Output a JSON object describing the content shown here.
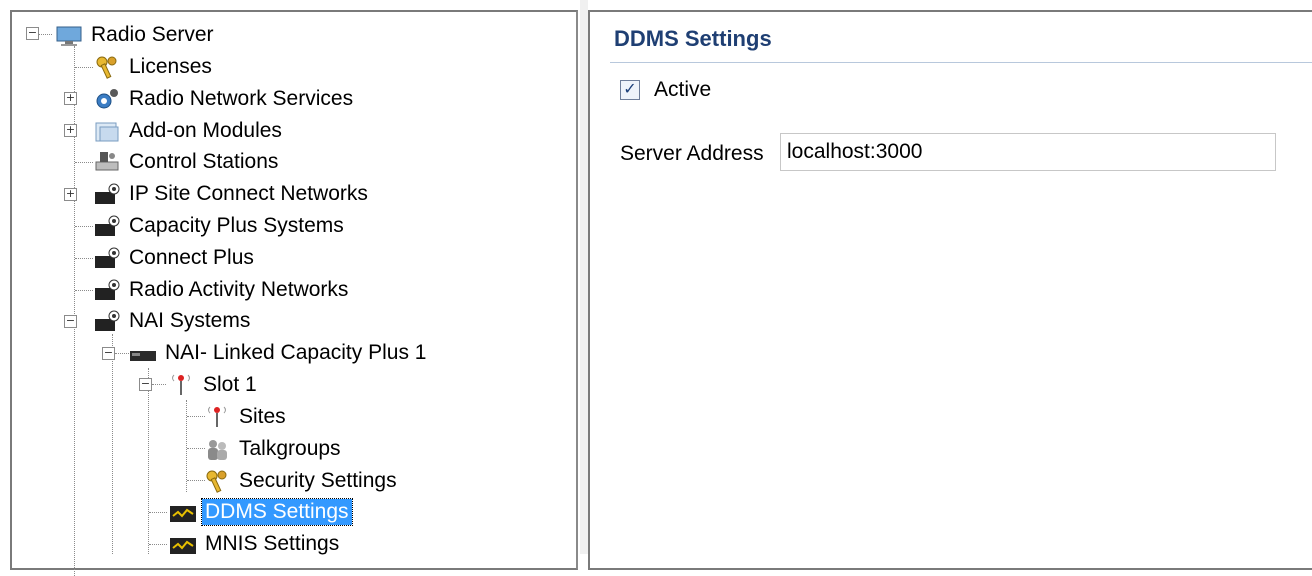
{
  "tree": {
    "nodes": [
      {
        "id": "radio_server",
        "label": "Radio Server",
        "icon": "monitor-icon"
      },
      {
        "id": "licenses",
        "label": "Licenses",
        "icon": "keys-icon"
      },
      {
        "id": "radio_network_services",
        "label": "Radio Network Services",
        "icon": "gear-network-icon"
      },
      {
        "id": "addon_modules",
        "label": "Add-on Modules",
        "icon": "modules-icon"
      },
      {
        "id": "control_stations",
        "label": "Control Stations",
        "icon": "radio-station-icon"
      },
      {
        "id": "ip_site_connect",
        "label": "IP Site Connect Networks",
        "icon": "network-device-icon"
      },
      {
        "id": "capacity_plus",
        "label": "Capacity Plus Systems",
        "icon": "network-device-icon"
      },
      {
        "id": "connect_plus",
        "label": "Connect Plus",
        "icon": "network-device-icon"
      },
      {
        "id": "radio_activity",
        "label": "Radio Activity Networks",
        "icon": "network-device-icon"
      },
      {
        "id": "nai_systems",
        "label": "NAI Systems",
        "icon": "network-device-icon"
      },
      {
        "id": "nai_linked",
        "label": "NAI- Linked Capacity Plus 1",
        "icon": "repeater-icon"
      },
      {
        "id": "slot1",
        "label": "Slot 1",
        "icon": "antenna-icon"
      },
      {
        "id": "sites",
        "label": "Sites",
        "icon": "antenna-icon"
      },
      {
        "id": "talkgroups",
        "label": "Talkgroups",
        "icon": "talkgroup-icon"
      },
      {
        "id": "security_settings",
        "label": "Security Settings",
        "icon": "keys-icon"
      },
      {
        "id": "ddms_settings",
        "label": "DDMS Settings",
        "icon": "ddms-icon"
      },
      {
        "id": "mnis_settings",
        "label": "MNIS Settings",
        "icon": "ddms-icon"
      }
    ],
    "selected": "DDMS Settings"
  },
  "settings": {
    "title": "DDMS Settings",
    "active_label": "Active",
    "active_checked": true,
    "server_address_label": "Server Address",
    "server_address_value": "localhost:3000"
  }
}
